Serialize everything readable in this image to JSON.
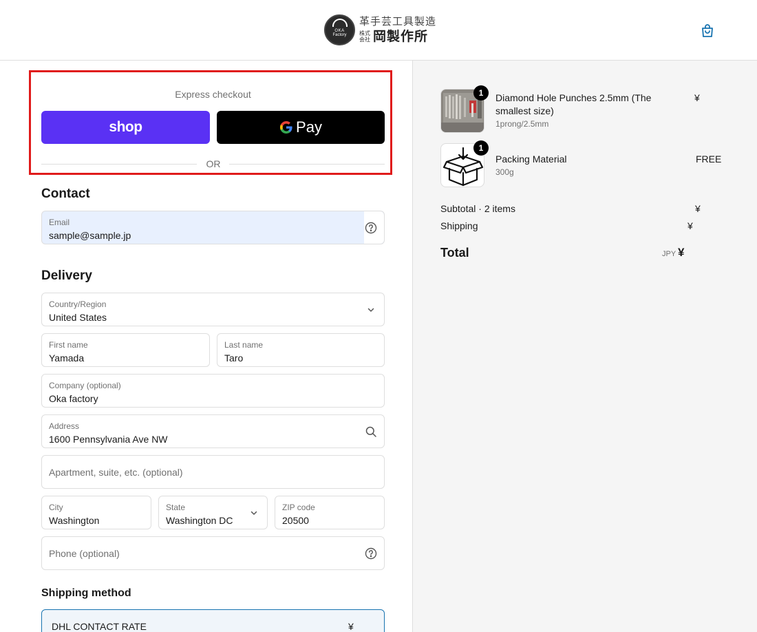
{
  "header": {
    "logo_badge_line1": "OKA",
    "logo_badge_line2": "Factory",
    "logo_tagline": "革手芸工具製造",
    "logo_kaisha": "株式会社",
    "logo_name": "岡製作所",
    "cart_icon": "shopping-bag-icon"
  },
  "express": {
    "title": "Express checkout",
    "shop_label": "shop",
    "gpay_g": "G",
    "gpay_label": "Pay",
    "or_label": "OR"
  },
  "contact": {
    "title": "Contact",
    "email_label": "Email",
    "email_value": "sample@sample.jp"
  },
  "delivery": {
    "title": "Delivery",
    "country_label": "Country/Region",
    "country_value": "United States",
    "first_name_label": "First name",
    "first_name_value": "Yamada",
    "last_name_label": "Last name",
    "last_name_value": "Taro",
    "company_label": "Company (optional)",
    "company_value": "Oka factory",
    "address_label": "Address",
    "address_value": "1600 Pennsylvania Ave NW",
    "apartment_placeholder": "Apartment, suite, etc. (optional)",
    "city_label": "City",
    "city_value": "Washington",
    "state_label": "State",
    "state_value": "Washington DC",
    "zip_label": "ZIP code",
    "zip_value": "20500",
    "phone_placeholder": "Phone (optional)"
  },
  "shipping_method": {
    "title": "Shipping method",
    "option_name": "DHL CONTACT RATE",
    "option_price": "¥"
  },
  "summary": {
    "items": [
      {
        "name": "Diamond Hole Punches 2.5mm (The smallest size)",
        "variant": "1prong/2.5mm",
        "price": "¥",
        "quantity": "1"
      },
      {
        "name": "Packing Material",
        "variant": "300g",
        "price": "FREE",
        "quantity": "1"
      }
    ],
    "subtotal_label": "Subtotal · 2 items",
    "subtotal_value": "¥",
    "shipping_label": "Shipping",
    "shipping_value": "¥",
    "total_label": "Total",
    "total_currency": "JPY",
    "total_value": "¥"
  },
  "colors": {
    "shop_pay": "#5a31f4",
    "highlight_border": "#e01b1b",
    "selected_border": "#1773b0",
    "autofill_bg": "#e8f0fe"
  }
}
